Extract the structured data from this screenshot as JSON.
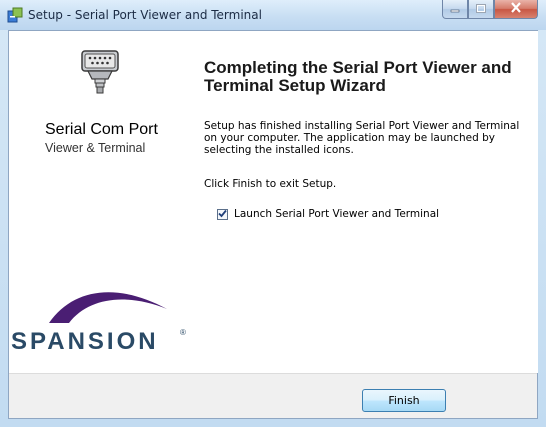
{
  "window": {
    "title": "Setup - Serial Port Viewer and Terminal"
  },
  "side_panel": {
    "brand_title": "Serial Com Port",
    "brand_subtitle": "Viewer & Terminal",
    "logo_text": "SPANSION",
    "logo_mark": "®"
  },
  "main": {
    "heading": "Completing the Serial Port Viewer and Terminal Setup Wizard",
    "paragraph1": "Setup has finished installing Serial Port Viewer and Terminal on your computer. The application may be launched by selecting the installed icons.",
    "paragraph2": "Click Finish to exit Setup.",
    "launch_checkbox": {
      "label": "Launch Serial Port Viewer and Terminal",
      "checked": true
    }
  },
  "buttons": {
    "finish": "Finish"
  },
  "icons": {
    "app": "setup-icon",
    "connector": "serial-connector-icon",
    "minimize": "minimize-icon",
    "maximize": "maximize-icon",
    "close": "close-icon",
    "check": "check-icon"
  },
  "colors": {
    "logo_purple": "#4a1e73",
    "logo_text": "#2a4a66",
    "close_red": "#c85643"
  }
}
